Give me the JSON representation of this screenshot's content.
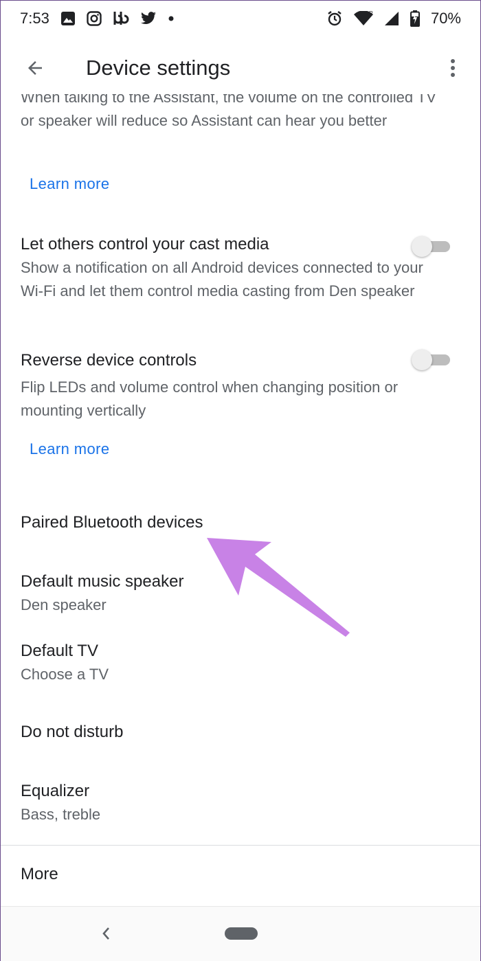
{
  "status_bar": {
    "time": "7:53",
    "battery_pct": "70%",
    "left_icons": [
      "gallery-icon",
      "instagram-icon",
      "bebee-icon",
      "twitter-icon",
      "dot-icon"
    ],
    "right_icons": [
      "alarm-icon",
      "wifi-icon",
      "signal-icon",
      "battery-charging-icon"
    ],
    "roaming_mark": "R"
  },
  "app_bar": {
    "title": "Device settings"
  },
  "intro": {
    "text": "When talking to the Assistant, the volume on the controlled TV or speaker will reduce so Assistant can hear you better",
    "learn_more": "Learn more"
  },
  "settings": [
    {
      "title": "Let others control your cast media",
      "description": "Show a notification on all Android devices connected to your Wi-Fi and let them control media casting from Den speaker",
      "toggle_on": false
    },
    {
      "title": "Reverse device controls",
      "description": "Flip LEDs and volume control when changing position or mounting vertically",
      "toggle_on": false,
      "learn_more": "Learn more"
    }
  ],
  "list": [
    {
      "title": "Paired Bluetooth devices"
    },
    {
      "title": "Default music speaker",
      "subtitle": "Den speaker"
    },
    {
      "title": "Default TV",
      "subtitle": "Choose a TV"
    },
    {
      "title": "Do not disturb"
    },
    {
      "title": "Equalizer",
      "subtitle": "Bass, treble"
    }
  ],
  "more": {
    "label": "More"
  },
  "colors": {
    "accent": "#1a73e8",
    "annotation_arrow": "#c882e6"
  }
}
